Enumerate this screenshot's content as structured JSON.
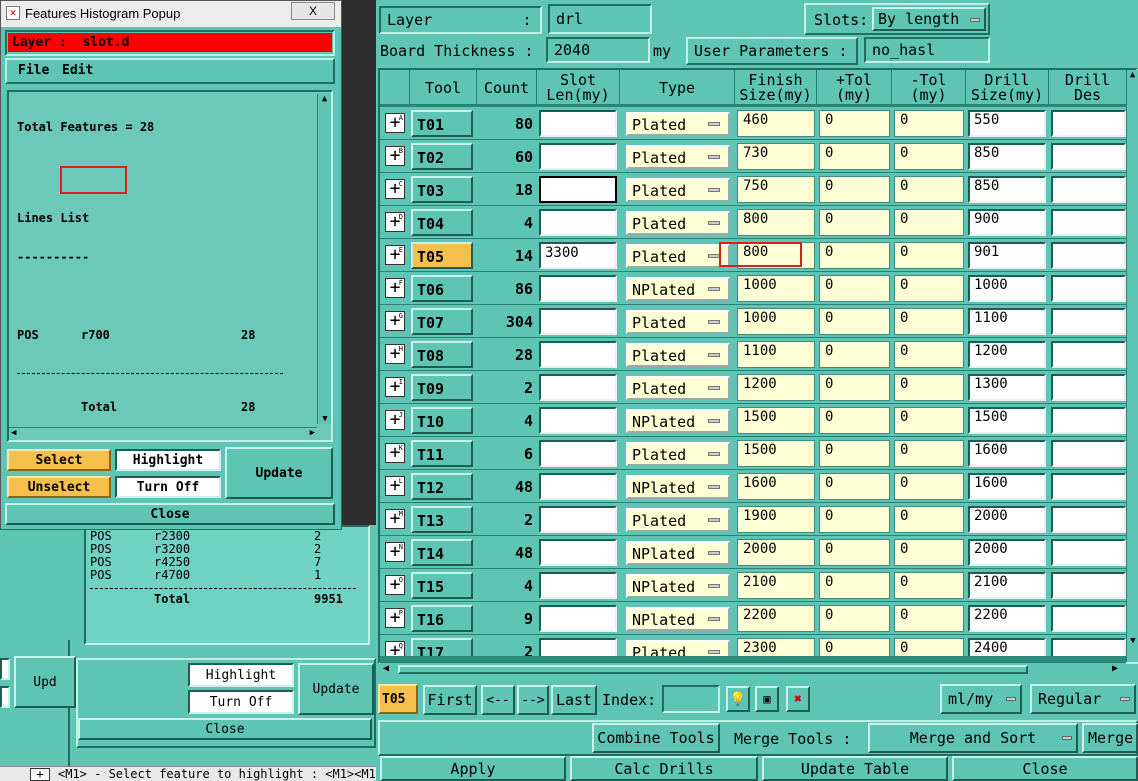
{
  "background_panel": {
    "text_lines": [
      {
        "type": "POS",
        "sym": "r2300",
        "count": "2"
      },
      {
        "type": "POS",
        "sym": "r3200",
        "count": "2"
      },
      {
        "type": "POS",
        "sym": "r4250",
        "count": "7"
      },
      {
        "type": "POS",
        "sym": "r4700",
        "count": "1"
      }
    ],
    "total_label": "Total",
    "total_value": "9951",
    "highlight_label": "Highlight",
    "turnoff_label": "Turn Off",
    "update_label": "Update",
    "close_label": "Close",
    "left_update_label": "Upd"
  },
  "popup": {
    "title": "Features Histogram Popup",
    "close_x": "X",
    "layer_text": "Layer :  slot.d",
    "menu": {
      "file": "File",
      "edit": "Edit"
    },
    "content": {
      "total_features": "Total Features = 28",
      "lines_list": "Lines List",
      "underline": "----------",
      "row": {
        "type": "POS",
        "sym": "r700",
        "count": "28"
      },
      "divider": "-------------------------------------",
      "total_label": "Total",
      "total_value": "28"
    },
    "buttons": {
      "select": "Select",
      "unselect": "Unselect",
      "highlight": "Highlight",
      "turn_off": "Turn Off",
      "update": "Update",
      "close": "Close"
    }
  },
  "main": {
    "layer_label": "Layer          :",
    "layer_value": "drl",
    "slots_label": "Slots:",
    "slots_value": "By length",
    "board_thickness_label": "Board Thickness :",
    "board_thickness_value": "2040",
    "board_thickness_unit": "my",
    "user_params_label": "User Parameters :",
    "user_params_value": "no_hasl",
    "columns": [
      {
        "key": "tool",
        "line1": "Tool",
        "line2": ""
      },
      {
        "key": "count",
        "line1": "Count",
        "line2": ""
      },
      {
        "key": "slot",
        "line1": "Slot",
        "line2": "Len(my)"
      },
      {
        "key": "type",
        "line1": "Type",
        "line2": ""
      },
      {
        "key": "finish",
        "line1": "Finish",
        "line2": "Size(my)"
      },
      {
        "key": "ptol",
        "line1": "+Tol",
        "line2": "(my)"
      },
      {
        "key": "mtol",
        "line1": "-Tol",
        "line2": "(my)"
      },
      {
        "key": "drill",
        "line1": "Drill",
        "line2": "Size(my)"
      },
      {
        "key": "des",
        "line1": "Drill",
        "line2": "Des"
      }
    ],
    "rows": [
      {
        "tool": "T01",
        "count": "80",
        "slot": "",
        "type": "Plated",
        "finish": "460",
        "ptol": "0",
        "mtol": "0",
        "drill": "550"
      },
      {
        "tool": "T02",
        "count": "60",
        "slot": "",
        "type": "Plated",
        "finish": "730",
        "ptol": "0",
        "mtol": "0",
        "drill": "850"
      },
      {
        "tool": "T03",
        "count": "18",
        "slot": "",
        "type": "Plated",
        "finish": "750",
        "ptol": "0",
        "mtol": "0",
        "drill": "850"
      },
      {
        "tool": "T04",
        "count": "4",
        "slot": "",
        "type": "Plated",
        "finish": "800",
        "ptol": "0",
        "mtol": "0",
        "drill": "900"
      },
      {
        "tool": "T05",
        "count": "14",
        "slot": "3300",
        "type": "Plated",
        "finish": "800",
        "ptol": "0",
        "mtol": "0",
        "drill": "901"
      },
      {
        "tool": "T06",
        "count": "86",
        "slot": "",
        "type": "NPlated",
        "finish": "1000",
        "ptol": "0",
        "mtol": "0",
        "drill": "1000"
      },
      {
        "tool": "T07",
        "count": "304",
        "slot": "",
        "type": "Plated",
        "finish": "1000",
        "ptol": "0",
        "mtol": "0",
        "drill": "1100"
      },
      {
        "tool": "T08",
        "count": "28",
        "slot": "",
        "type": "Plated",
        "finish": "1100",
        "ptol": "0",
        "mtol": "0",
        "drill": "1200"
      },
      {
        "tool": "T09",
        "count": "2",
        "slot": "",
        "type": "Plated",
        "finish": "1200",
        "ptol": "0",
        "mtol": "0",
        "drill": "1300"
      },
      {
        "tool": "T10",
        "count": "4",
        "slot": "",
        "type": "NPlated",
        "finish": "1500",
        "ptol": "0",
        "mtol": "0",
        "drill": "1500"
      },
      {
        "tool": "T11",
        "count": "6",
        "slot": "",
        "type": "Plated",
        "finish": "1500",
        "ptol": "0",
        "mtol": "0",
        "drill": "1600"
      },
      {
        "tool": "T12",
        "count": "48",
        "slot": "",
        "type": "NPlated",
        "finish": "1600",
        "ptol": "0",
        "mtol": "0",
        "drill": "1600"
      },
      {
        "tool": "T13",
        "count": "2",
        "slot": "",
        "type": "Plated",
        "finish": "1900",
        "ptol": "0",
        "mtol": "0",
        "drill": "2000"
      },
      {
        "tool": "T14",
        "count": "48",
        "slot": "",
        "type": "NPlated",
        "finish": "2000",
        "ptol": "0",
        "mtol": "0",
        "drill": "2000"
      },
      {
        "tool": "T15",
        "count": "4",
        "slot": "",
        "type": "NPlated",
        "finish": "2100",
        "ptol": "0",
        "mtol": "0",
        "drill": "2100"
      },
      {
        "tool": "T16",
        "count": "9",
        "slot": "",
        "type": "NPlated",
        "finish": "2200",
        "ptol": "0",
        "mtol": "0",
        "drill": "2200"
      },
      {
        "tool": "T17",
        "count": "2",
        "slot": "",
        "type": "Plated",
        "finish": "2300",
        "ptol": "0",
        "mtol": "0",
        "drill": "2400"
      }
    ],
    "plus_markers": [
      "A",
      "B",
      "C",
      "D",
      "E",
      "F",
      "G",
      "H",
      "I",
      "J",
      "K",
      "L",
      "M",
      "N",
      "O",
      "P",
      "Q"
    ],
    "selected_tool": "T05",
    "nav": {
      "first": "First",
      "prev": "<--",
      "next": "-->",
      "last": "Last",
      "index_label": "Index:",
      "units": "ml/my",
      "mode": "Regular"
    },
    "tools": {
      "combine": "Combine Tools",
      "merge_label": "Merge Tools :",
      "merge_value": "Merge and Sort",
      "merge_btn": "Merge"
    },
    "bottom": {
      "apply": "Apply",
      "calc": "Calc Drills",
      "update_table": "Update Table",
      "close": "Close"
    }
  },
  "status_bar": "<M1> - Select feature to highlight : <M1><M1"
}
